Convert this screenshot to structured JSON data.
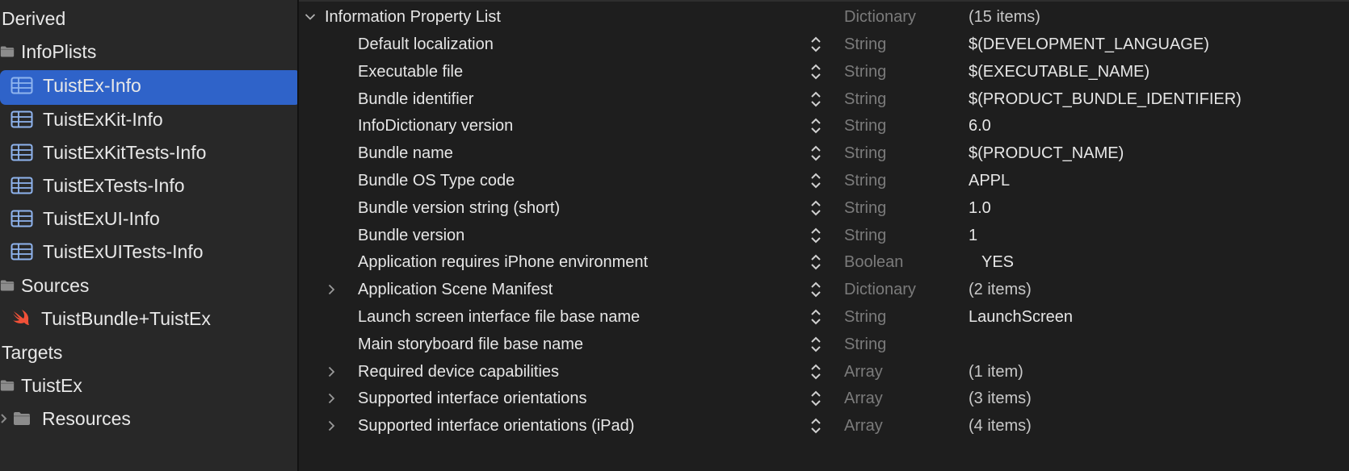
{
  "sidebar": {
    "items": [
      {
        "label": "Derived",
        "icon": "none",
        "kind": "header"
      },
      {
        "label": "InfoPlists",
        "icon": "folder-icon",
        "kind": "group"
      },
      {
        "label": "TuistEx-Info",
        "icon": "plist-icon",
        "kind": "file",
        "selected": true
      },
      {
        "label": "TuistExKit-Info",
        "icon": "plist-icon",
        "kind": "file"
      },
      {
        "label": "TuistExKitTests-Info",
        "icon": "plist-icon",
        "kind": "file"
      },
      {
        "label": "TuistExTests-Info",
        "icon": "plist-icon",
        "kind": "file"
      },
      {
        "label": "TuistExUI-Info",
        "icon": "plist-icon",
        "kind": "file"
      },
      {
        "label": "TuistExUITests-Info",
        "icon": "plist-icon",
        "kind": "file"
      },
      {
        "label": "Sources",
        "icon": "folder-icon",
        "kind": "group"
      },
      {
        "label": "TuistBundle+TuistEx",
        "icon": "swift-icon",
        "kind": "file"
      },
      {
        "label": "Targets",
        "icon": "none",
        "kind": "header"
      },
      {
        "label": "TuistEx",
        "icon": "folder-icon",
        "kind": "group"
      },
      {
        "label": "Resources",
        "icon": "folder-icon",
        "kind": "group-collapsed"
      }
    ]
  },
  "plist": {
    "root": {
      "key": "Information Property List",
      "type": "Dictionary",
      "value": "(15 items)"
    },
    "rows": [
      {
        "key": "Default localization",
        "type": "String",
        "value": "$(DEVELOPMENT_LANGUAGE)",
        "expandable": false
      },
      {
        "key": "Executable file",
        "type": "String",
        "value": "$(EXECUTABLE_NAME)",
        "expandable": false
      },
      {
        "key": "Bundle identifier",
        "type": "String",
        "value": "$(PRODUCT_BUNDLE_IDENTIFIER)",
        "expandable": false
      },
      {
        "key": "InfoDictionary version",
        "type": "String",
        "value": "6.0",
        "expandable": false
      },
      {
        "key": "Bundle name",
        "type": "String",
        "value": "$(PRODUCT_NAME)",
        "expandable": false
      },
      {
        "key": "Bundle OS Type code",
        "type": "String",
        "value": "APPL",
        "expandable": false
      },
      {
        "key": "Bundle version string (short)",
        "type": "String",
        "value": "1.0",
        "expandable": false
      },
      {
        "key": "Bundle version",
        "type": "String",
        "value": "1",
        "expandable": false
      },
      {
        "key": "Application requires iPhone environment",
        "type": "Boolean",
        "value": "YES",
        "expandable": false
      },
      {
        "key": "Application Scene Manifest",
        "type": "Dictionary",
        "value": "(2 items)",
        "expandable": true
      },
      {
        "key": "Launch screen interface file base name",
        "type": "String",
        "value": "LaunchScreen",
        "expandable": false
      },
      {
        "key": "Main storyboard file base name",
        "type": "String",
        "value": "",
        "expandable": false
      },
      {
        "key": "Required device capabilities",
        "type": "Array",
        "value": "(1 item)",
        "expandable": true
      },
      {
        "key": "Supported interface orientations",
        "type": "Array",
        "value": "(3 items)",
        "expandable": true
      },
      {
        "key": "Supported interface orientations (iPad)",
        "type": "Array",
        "value": "(4 items)",
        "expandable": true
      }
    ]
  },
  "colors": {
    "selection": "#2f63c9",
    "sidebar_bg": "#282828",
    "editor_bg": "#1e1e1e",
    "type_text": "#7b7b7b",
    "swift_orange": "#f05138"
  }
}
